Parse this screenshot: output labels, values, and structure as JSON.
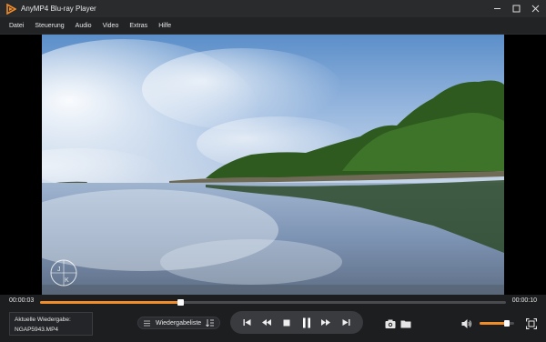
{
  "window": {
    "title": "AnyMP4 Blu-ray Player",
    "brand_color": "#f08d2a",
    "controls": [
      "minimize-icon",
      "restore-icon",
      "close-icon"
    ]
  },
  "menu": {
    "items": [
      "Datei",
      "Steuerung",
      "Audio",
      "Video",
      "Extras",
      "Hilfe"
    ]
  },
  "video": {
    "watermark_icon": "compass-monogram-icon",
    "watermark_text": "J K"
  },
  "playback": {
    "current_time": "00:00:03",
    "total_time": "00:00:10",
    "progress_fraction": 0.3,
    "volume_fraction": 0.8
  },
  "now_playing": {
    "label": "Aktuelle Wiedergabe:",
    "file": "NGAP5943.MP4"
  },
  "playlist": {
    "label": "Wiedergabeliste",
    "icon": "list-icon",
    "sort_icon": "sort-icon"
  },
  "transport": {
    "buttons": [
      "skip-previous-icon",
      "rewind-icon",
      "stop-icon",
      "pause-icon",
      "fast-forward-icon",
      "skip-next-icon"
    ]
  },
  "tools": [
    "camera-icon",
    "folder-icon",
    "volume-icon",
    "fullscreen-icon"
  ]
}
